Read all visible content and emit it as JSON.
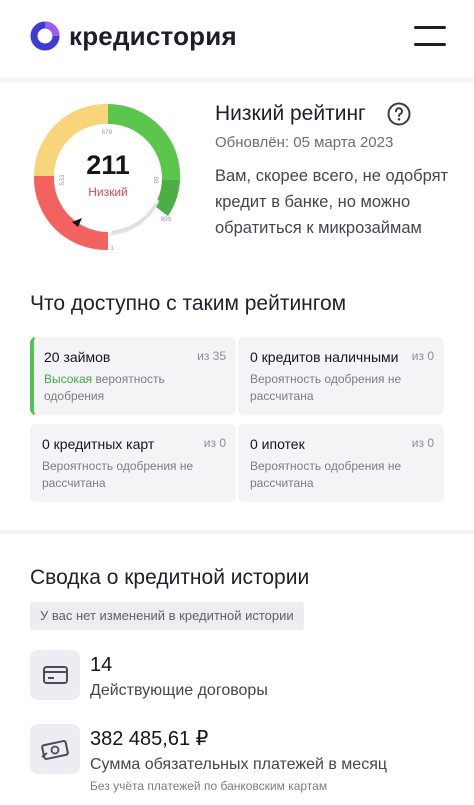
{
  "header": {
    "logo_text": "кредистория",
    "brand_colors": {
      "ring_dark": "#3b3bd6",
      "ring_light": "#9b5cf6"
    }
  },
  "rating": {
    "score": "211",
    "score_label": "Низкий",
    "title": "Низкий рейтинг",
    "updated": "Обновлён: 05 марта 2023",
    "advice": "Вам, скорее всего, не одобрят кредит в банке, но можно обратиться к микрозаймам",
    "scale_ticks": [
      "1",
      "533",
      "678",
      "88",
      "999"
    ],
    "segment_colors": [
      "#f2625e",
      "#f8d57a",
      "#5cc54e",
      "#e4e4ea"
    ],
    "scale_min": 1,
    "scale_max": 999
  },
  "available": {
    "title": "Что доступно с таким рейтингом",
    "items": [
      {
        "name": "20 займов",
        "of": "из 35",
        "desc_highlight": "Высокая",
        "desc": " вероятность одобрения"
      },
      {
        "name": "0 кредитов наличными",
        "of": "из 0",
        "desc_highlight": "",
        "desc": "Вероятность одобрения не рассчитана"
      },
      {
        "name": "0 кредитных карт",
        "of": "из 0",
        "desc_highlight": "",
        "desc": "Вероятность одобрения не рассчитана"
      },
      {
        "name": "0 ипотек",
        "of": "из 0",
        "desc_highlight": "",
        "desc": "Вероятность одобрения не рассчитана"
      }
    ]
  },
  "summary": {
    "title": "Сводка о кредитной истории",
    "no_changes": "У вас нет изменений в кредитной истории",
    "contracts_value": "14",
    "contracts_label": "Действующие договоры",
    "payments_value": "382 485,61 ₽",
    "payments_label": "Сумма обязательных платежей в месяц",
    "payments_note": "Без учёта платежей по банковским картам",
    "icons": [
      "card-icon",
      "cash-icon"
    ]
  }
}
